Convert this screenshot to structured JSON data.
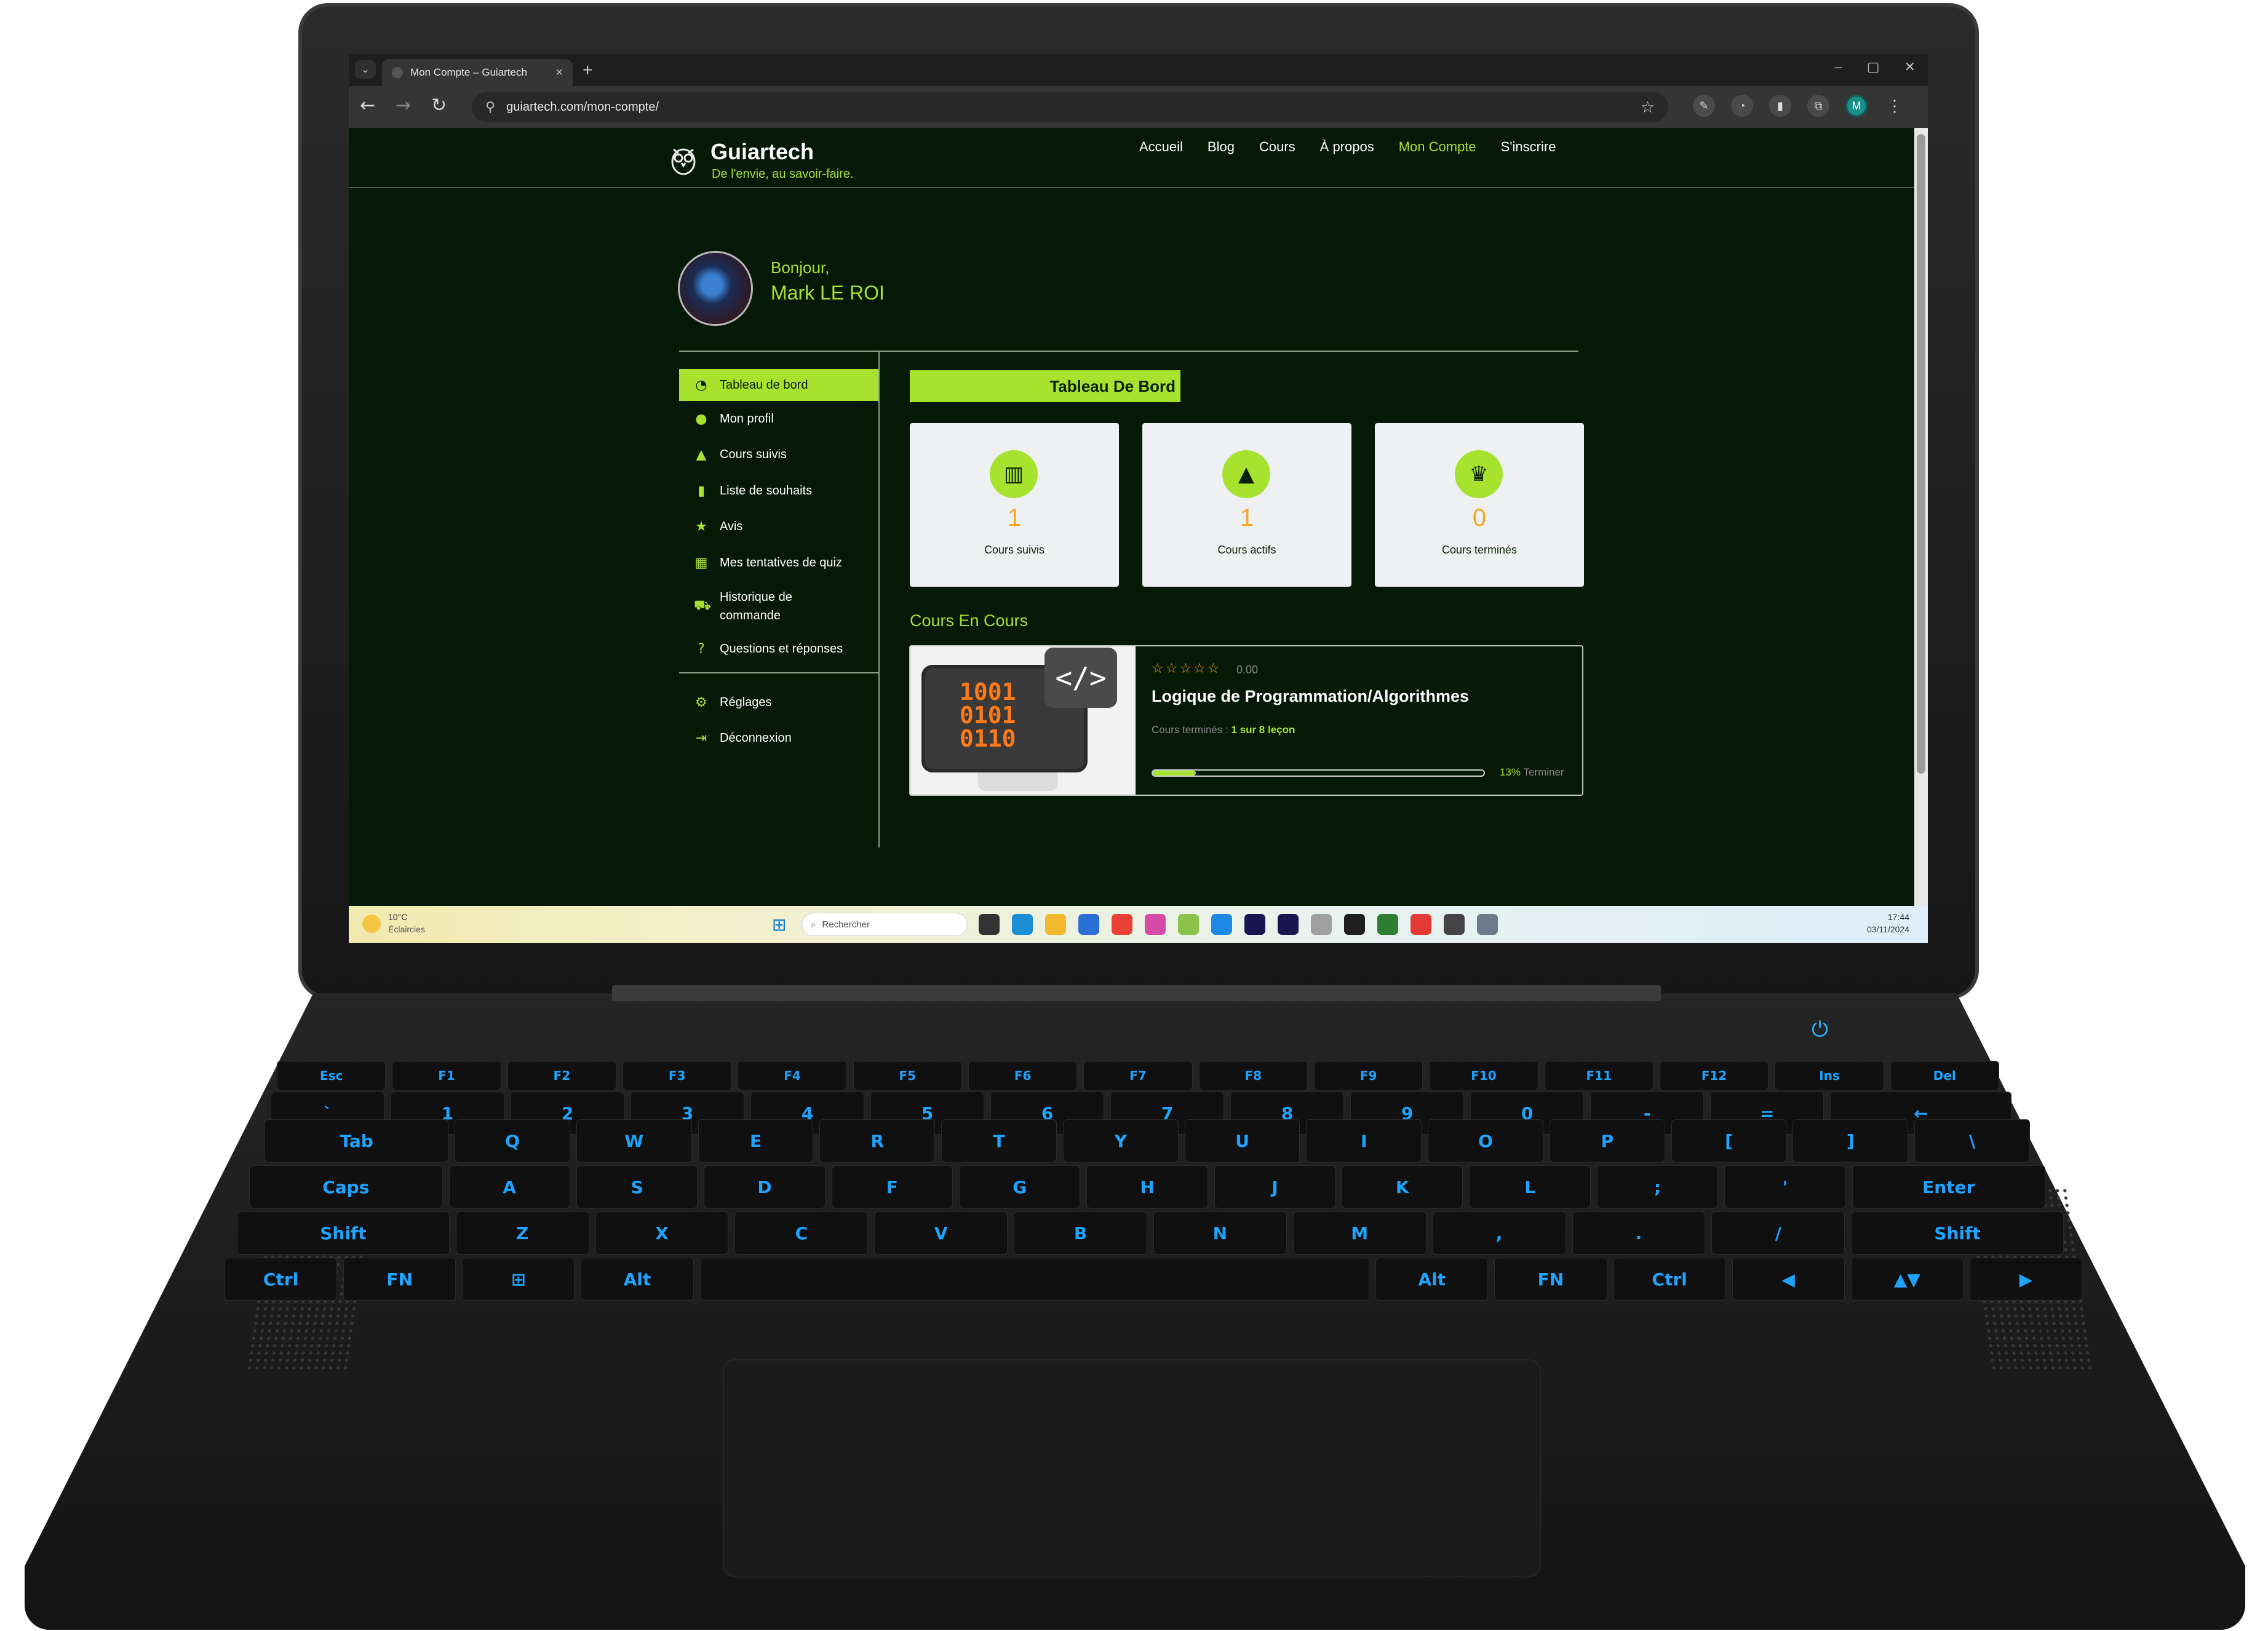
{
  "browser": {
    "tab_title": "Mon Compte – Guiartech",
    "tab_close": "×",
    "new_tab": "+",
    "tab_dropdown": "⌄",
    "url": "guiartech.com/mon-compte/",
    "back": "←",
    "forward": "→",
    "reload": "↻",
    "bookmark_star": "☆",
    "window_controls": [
      "–",
      "▢",
      "✕"
    ],
    "extensions": [
      "✎",
      "◔",
      "▮",
      "⧉"
    ],
    "profile_initial": "M",
    "menu": "⋮"
  },
  "site": {
    "brand": "Guiartech",
    "tagline": "De l'envie, au savoir-faire.",
    "nav": [
      {
        "label": "Accueil"
      },
      {
        "label": "Blog"
      },
      {
        "label": "Cours"
      },
      {
        "label": "À propos"
      },
      {
        "label": "Mon Compte",
        "active": true
      },
      {
        "label": "S'inscrire"
      }
    ],
    "accent_color": "#a6e22e",
    "background_color": "#061806"
  },
  "profile": {
    "greeting": "Bonjour,",
    "name": "Mark LE ROI"
  },
  "sidebar": {
    "items": [
      {
        "label": "Tableau de bord",
        "icon": "gauge-icon",
        "glyph": "◔",
        "active": true
      },
      {
        "label": "Mon profil",
        "icon": "user-icon",
        "glyph": "●"
      },
      {
        "label": "Cours suivis",
        "icon": "graduation-cap-icon",
        "glyph": "▲"
      },
      {
        "label": "Liste de souhaits",
        "icon": "bookmark-icon",
        "glyph": "▮"
      },
      {
        "label": "Avis",
        "icon": "star-icon",
        "glyph": "★"
      },
      {
        "label": "Mes tentatives de quiz",
        "icon": "puzzle-icon",
        "glyph": "▦"
      },
      {
        "label": "Historique de commande",
        "icon": "cart-icon",
        "glyph": "⛟"
      },
      {
        "label": "Questions et réponses",
        "icon": "question-icon",
        "glyph": "?"
      }
    ],
    "bottom_items": [
      {
        "label": "Réglages",
        "icon": "gear-icon",
        "glyph": "⚙"
      },
      {
        "label": "Déconnexion",
        "icon": "logout-icon",
        "glyph": "⇥"
      }
    ]
  },
  "dashboard": {
    "title": "Tableau De Bord",
    "stats": [
      {
        "value": "1",
        "label": "Cours suivis",
        "icon": "book-icon",
        "glyph": "▥"
      },
      {
        "value": "1",
        "label": "Cours actifs",
        "icon": "graduation-cap-icon",
        "glyph": "▲"
      },
      {
        "value": "0",
        "label": "Cours terminés",
        "icon": "trophy-icon",
        "glyph": "♛"
      }
    ],
    "in_progress_heading": "Cours En Cours",
    "course": {
      "thumbnail_binary": [
        "1001",
        "0101",
        "0110"
      ],
      "thumbnail_badge": "</>",
      "stars": "☆☆☆☆☆",
      "rating": "0.00",
      "title": "Logique de Programmation/Algorithmes",
      "lessons_label": "Cours terminés :",
      "lessons_value": "1 sur 8 leçon",
      "progress_percent": 13,
      "progress_label": "13%",
      "progress_suffix": "Terminer"
    }
  },
  "taskbar": {
    "weather_temp": "10°C",
    "weather_desc": "Éclaircies",
    "start_glyph": "⊞",
    "search_glyph": "⌕",
    "search_placeholder": "Rechercher",
    "time": "17:44",
    "date": "03/11/2024",
    "apps": [
      {
        "name": "task-view",
        "color": "#333333"
      },
      {
        "name": "edge",
        "color": "#1b8fd6"
      },
      {
        "name": "explorer",
        "color": "#f3b92c"
      },
      {
        "name": "store",
        "color": "#2a6fd6"
      },
      {
        "name": "chrome",
        "color": "#e94235"
      },
      {
        "name": "photos",
        "color": "#d64ba7"
      },
      {
        "name": "git",
        "color": "#8bc34a"
      },
      {
        "name": "vscode",
        "color": "#1e88e5"
      },
      {
        "name": "premiere",
        "color": "#1a1450"
      },
      {
        "name": "after-effects",
        "color": "#1a1450"
      },
      {
        "name": "figma-like",
        "color": "#a0a0a0"
      },
      {
        "name": "figma",
        "color": "#1e1e1e"
      },
      {
        "name": "app-green",
        "color": "#2e7d32"
      },
      {
        "name": "youtube",
        "color": "#e53935"
      },
      {
        "name": "chatgpt",
        "color": "#444444"
      },
      {
        "name": "settings",
        "color": "#6c7a89"
      }
    ]
  },
  "keyboard": {
    "rows": [
      [
        "Esc",
        "F1",
        "F2",
        "F3",
        "F4",
        "F5",
        "F6",
        "F7",
        "F8",
        "F9",
        "F10",
        "F11",
        "F12",
        "Ins",
        "Del"
      ],
      [
        "`",
        "1",
        "2",
        "3",
        "4",
        "5",
        "6",
        "7",
        "8",
        "9",
        "0",
        "-",
        "=",
        "←"
      ],
      [
        "Tab",
        "Q",
        "W",
        "E",
        "R",
        "T",
        "Y",
        "U",
        "I",
        "O",
        "P",
        "[",
        "]",
        "\\"
      ],
      [
        "Caps",
        "A",
        "S",
        "D",
        "F",
        "G",
        "H",
        "J",
        "K",
        "L",
        ";",
        "'",
        "Enter"
      ],
      [
        "Shift",
        "Z",
        "X",
        "C",
        "V",
        "B",
        "N",
        "M",
        ",",
        ".",
        "/",
        "Shift"
      ],
      [
        "Ctrl",
        "FN",
        "⊞",
        "Alt",
        " ",
        "Alt",
        "FN",
        "Ctrl",
        "◀",
        "▲▼",
        "▶"
      ]
    ],
    "power_glyph": "⏻"
  }
}
